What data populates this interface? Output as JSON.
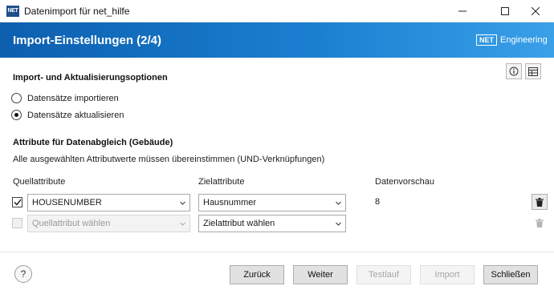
{
  "window": {
    "app_icon_text": "NET",
    "title": "Datenimport für net_hilfe"
  },
  "header": {
    "title": "Import-Einstellungen (2/4)",
    "brand_box": "NET",
    "brand_text": "Engineering",
    "gradient_colors": [
      "#0d5fae",
      "#3aa0e8"
    ]
  },
  "options": {
    "title": "Import- und Aktualisierungsoptionen",
    "radios": [
      {
        "label": "Datensätze importieren",
        "selected": false
      },
      {
        "label": "Datensätze aktualisieren",
        "selected": true
      }
    ],
    "icons": [
      "info-icon",
      "table-icon"
    ]
  },
  "matching": {
    "title": "Attribute für Datenabgleich (Gebäude)",
    "description": "Alle ausgewählten Attributwerte müssen übereinstimmen (UND-Verknüpfungen)",
    "columns": {
      "source": "Quellattribute",
      "target": "Zielattribute",
      "preview": "Datenvorschau"
    },
    "rows": [
      {
        "checked": true,
        "enabled": true,
        "source": "HOUSENUMBER",
        "target": "Hausnummer",
        "preview": "8"
      },
      {
        "checked": false,
        "enabled": false,
        "source": "Quellattribut wählen",
        "target": "Zielattribut wählen",
        "preview": ""
      }
    ]
  },
  "footer": {
    "help": "?",
    "buttons": {
      "back": "Zurück",
      "next": "Weiter",
      "test": "Testlauf",
      "import": "Import",
      "close": "Schließen"
    }
  }
}
